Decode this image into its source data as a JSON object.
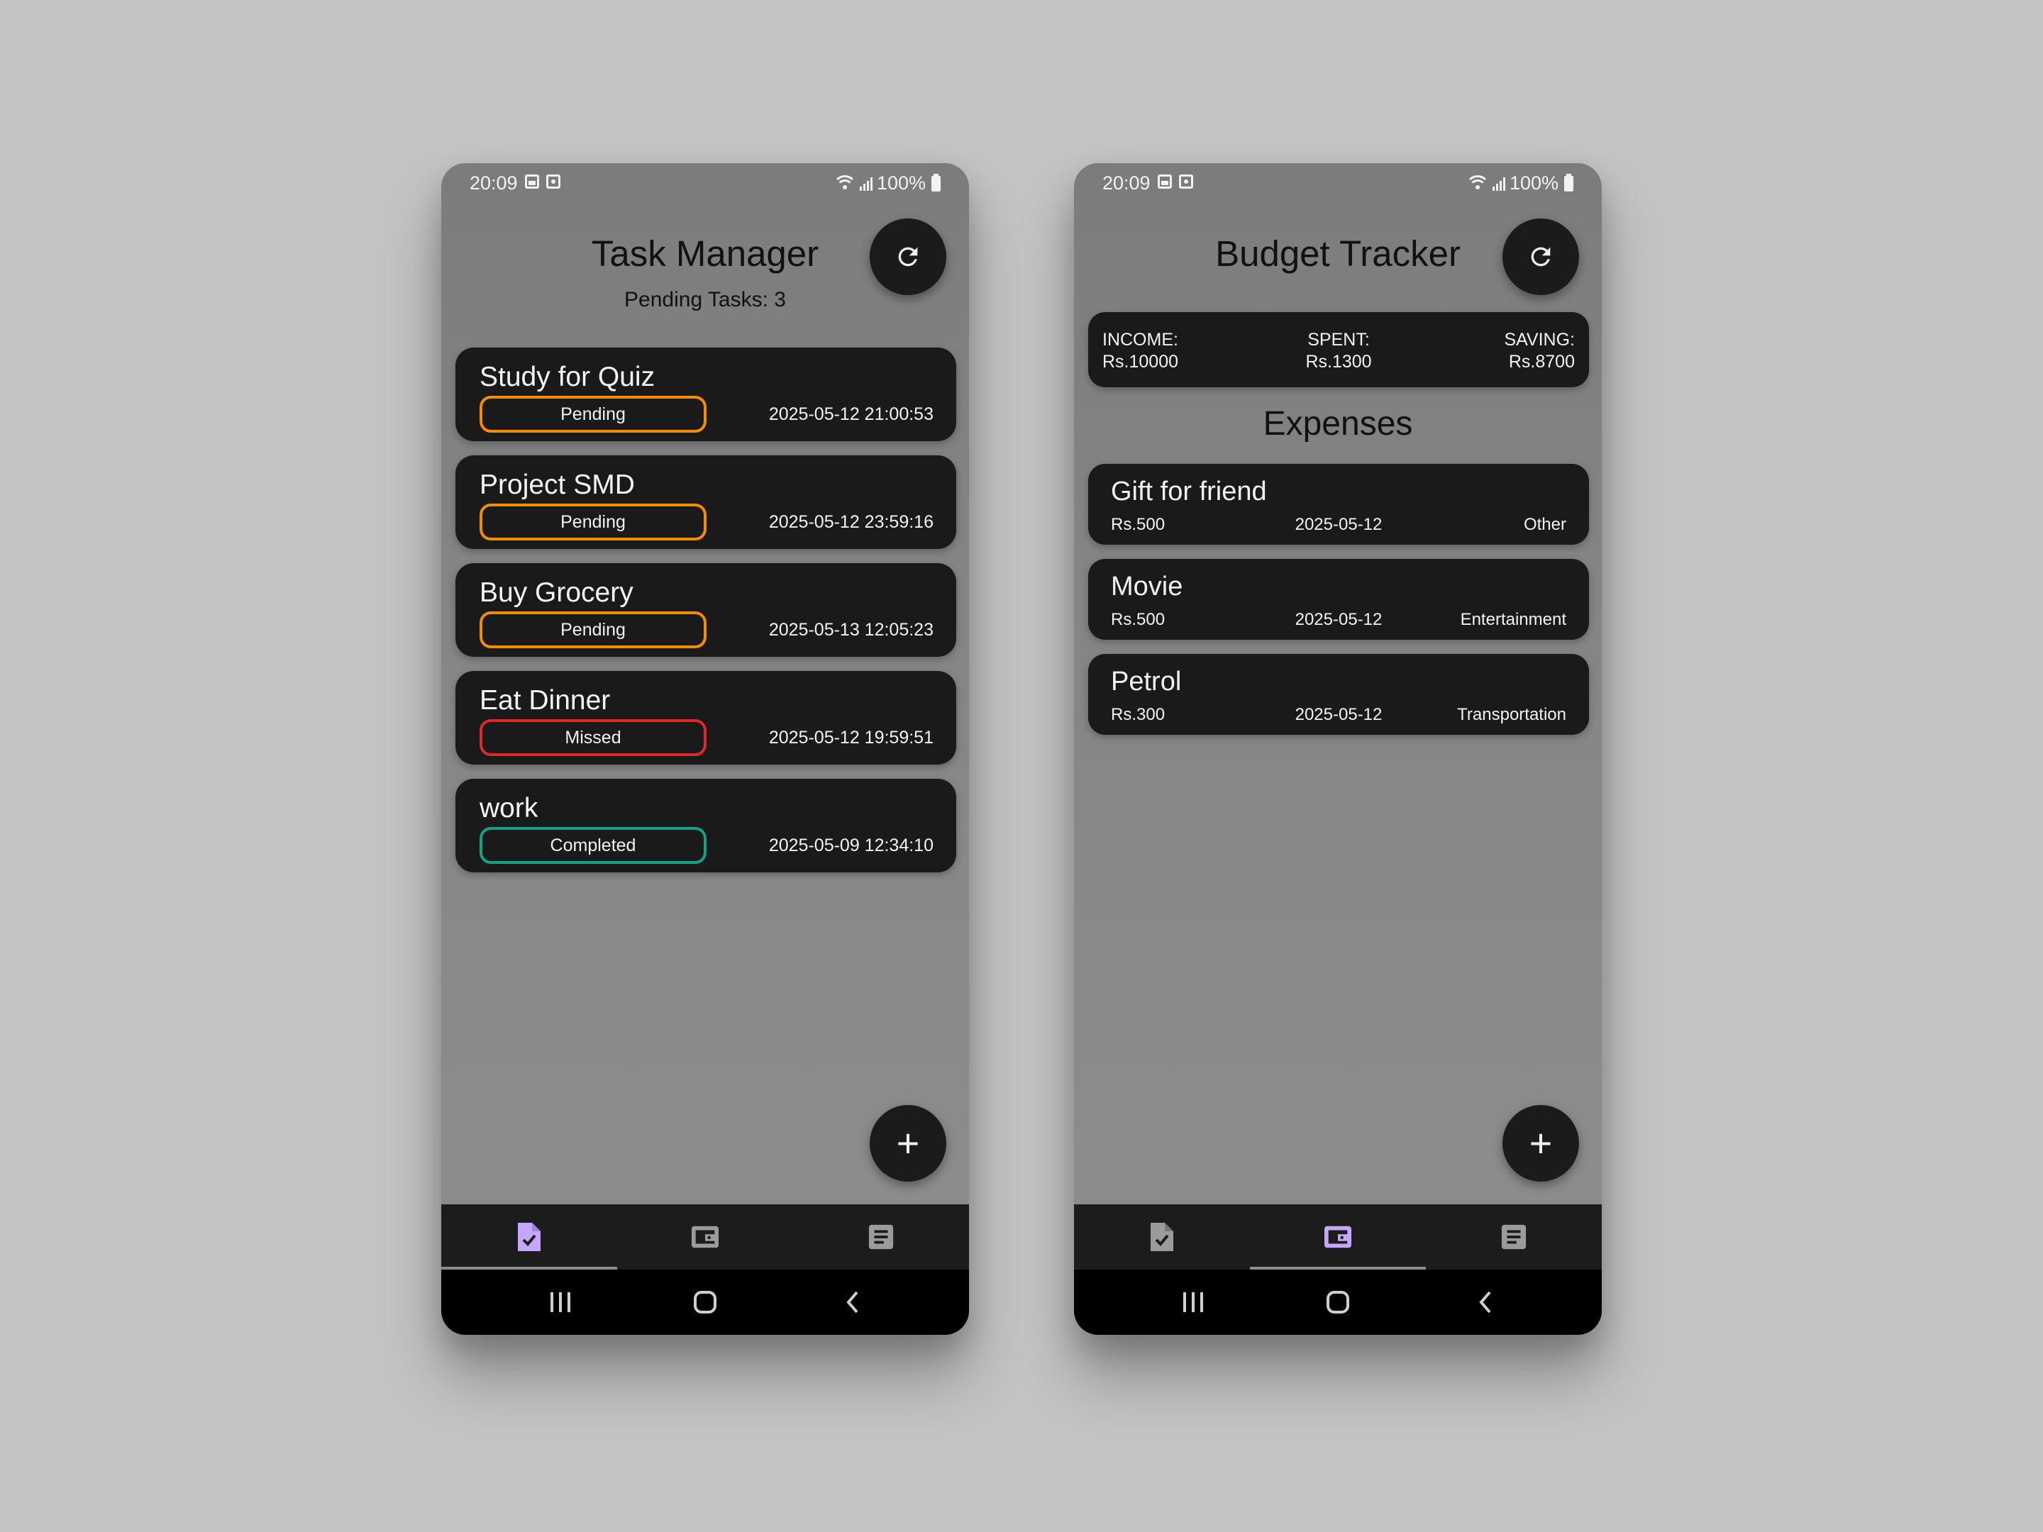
{
  "status_bar": {
    "time": "20:09",
    "battery": "100%"
  },
  "task_manager": {
    "title": "Task Manager",
    "pending_label": "Pending Tasks: 3",
    "tasks": [
      {
        "title": "Study for Quiz",
        "status": "Pending",
        "date": "2025-05-12 21:00:53"
      },
      {
        "title": "Project SMD",
        "status": "Pending",
        "date": "2025-05-12 23:59:16"
      },
      {
        "title": "Buy Grocery",
        "status": "Pending",
        "date": "2025-05-13 12:05:23"
      },
      {
        "title": "Eat Dinner",
        "status": "Missed",
        "date": "2025-05-12 19:59:51"
      },
      {
        "title": "work",
        "status": "Completed",
        "date": "2025-05-09 12:34:10"
      }
    ],
    "fab": "+"
  },
  "budget_tracker": {
    "title": "Budget Tracker",
    "summary": {
      "income_label": "INCOME:",
      "income_value": "Rs.10000",
      "spent_label": "SPENT:",
      "spent_value": "Rs.1300",
      "saving_label": "SAVING:",
      "saving_value": "Rs.8700"
    },
    "section_title": "Expenses",
    "expenses": [
      {
        "title": "Gift for friend",
        "amount": "Rs.500",
        "date": "2025-05-12",
        "category": "Other"
      },
      {
        "title": "Movie",
        "amount": "Rs.500",
        "date": "2025-05-12",
        "category": "Entertainment"
      },
      {
        "title": "Petrol",
        "amount": "Rs.300",
        "date": "2025-05-12",
        "category": "Transportation"
      }
    ],
    "fab": "+"
  },
  "icons": {
    "refresh": "refresh-icon",
    "tasks_tab": "task-document-icon",
    "wallet_tab": "wallet-icon",
    "notes_tab": "notes-icon"
  },
  "colors": {
    "pending": "#f28c00",
    "missed": "#e02828",
    "completed": "#18a083",
    "active_nav": "#c5a7ff",
    "inactive_nav": "#9b9b9b"
  }
}
